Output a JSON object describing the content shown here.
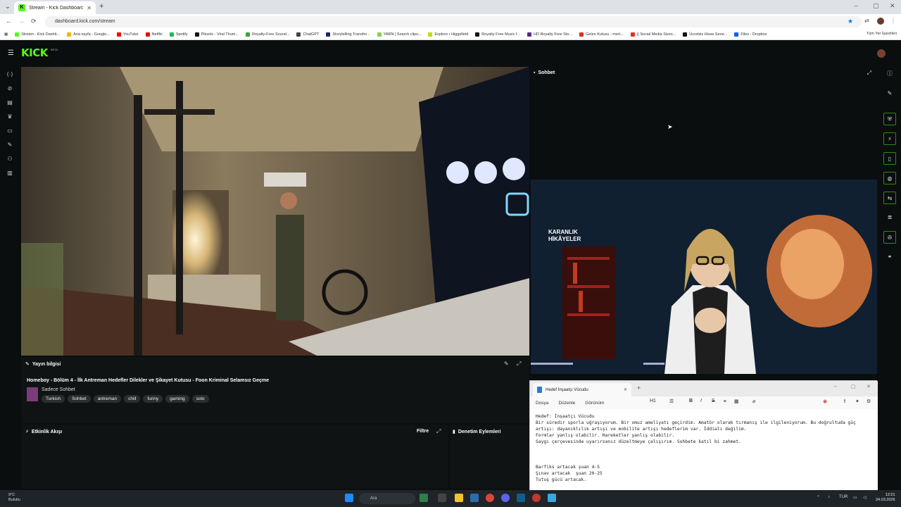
{
  "browser": {
    "tab_title": "Stream - Kick Dashboard",
    "tab_favicon": "K",
    "url": "dashboard.kick.com/stream",
    "bookmarks": [
      {
        "label": "Stream - Kick Dashb...",
        "color": "#53fc18"
      },
      {
        "label": "Ana sayfa - Google...",
        "color": "#f4b400"
      },
      {
        "label": "YouTube",
        "color": "#ff0000"
      },
      {
        "label": "Netflix",
        "color": "#e50914"
      },
      {
        "label": "Spotify",
        "color": "#1db954"
      },
      {
        "label": "Pikzels - Viral Thum...",
        "color": "#111111"
      },
      {
        "label": "Royalty-Free Sound...",
        "color": "#3aa335"
      },
      {
        "label": "ChatGPT",
        "color": "#444444"
      },
      {
        "label": "Storytelling Transfor...",
        "color": "#222266"
      },
      {
        "label": "YARN | Search clips...",
        "color": "#8ad04d"
      },
      {
        "label": "Explore • Higgsfield",
        "color": "#c8d80a"
      },
      {
        "label": "Royalty Free Music f...",
        "color": "#111111"
      },
      {
        "label": "HD Royalty Free Sto...",
        "color": "#5b2a86"
      },
      {
        "label": "Gelen Kutusu - mert...",
        "color": "#d93025"
      },
      {
        "label": "|| Social Media Sizes...",
        "color": "#e52d27"
      },
      {
        "label": "Ücretsiz Hisse Sene...",
        "color": "#111111"
      },
      {
        "label": "Files - Dropbox",
        "color": "#0061ff"
      }
    ],
    "bookmarks_more": "Tüm Yer İşaretleri"
  },
  "app": {
    "logo": "KICK",
    "logo_badge": "BETA",
    "chat_title": "Sohbet",
    "stream_info_title": "Yayın bilgisi",
    "stream_title": "Homeboy - Bölüm 4 - İlk Antreman Hedefler Dilekler ve Şikayet Kutusu - Foon Kriminal Selamsız Geçme",
    "category": "Sadece Sohbet",
    "tags": [
      "Turkish",
      "Sohbet",
      "antreman",
      "chill",
      "funny",
      "gaming",
      "solo"
    ],
    "activity_title": "Etkinlik Akışı",
    "filter_label": "Filtre",
    "moderation_title": "Denetim Eylemleri",
    "overlay_text_line1": "KARANLIK",
    "overlay_text_line2": "HİKÂYELER"
  },
  "notepad": {
    "tab_title": "Hedef İnşaatçı Vücudu",
    "menu": [
      "Dosya",
      "Düzenle",
      "Görünüm"
    ],
    "heading_select": "H1",
    "body": "Hedef: İnşaatçı Vücudu\nBir süredir sporla uğraşıyorum. Bir omuz ameliyatı geçirdim. Amatör olarak tırmanış ile ilgileniyorum. Bu doğrultuda güç\nartışı: dayanıklılık artışı ve mobilite artışı hedeflerim var. İddialı değilim.\nFormlar yanlış olabilir. Hareketler yanlış olabilir.\nSaygı çerçevesinde uyarırsanız düzeltmeye çalışırım. Sohbete katıl bi zahmet.\n\n\n\nBarfiks artacak şuan 4-5\nŞınav artacak  şuan 20-25\nTutuş gücü artacak."
  },
  "taskbar": {
    "weather_temp": "9°C",
    "weather_desc": "Bulutlu",
    "search_placeholder": "Ara",
    "language": "TUR",
    "time": "12:21",
    "date": "24.03.2026"
  }
}
